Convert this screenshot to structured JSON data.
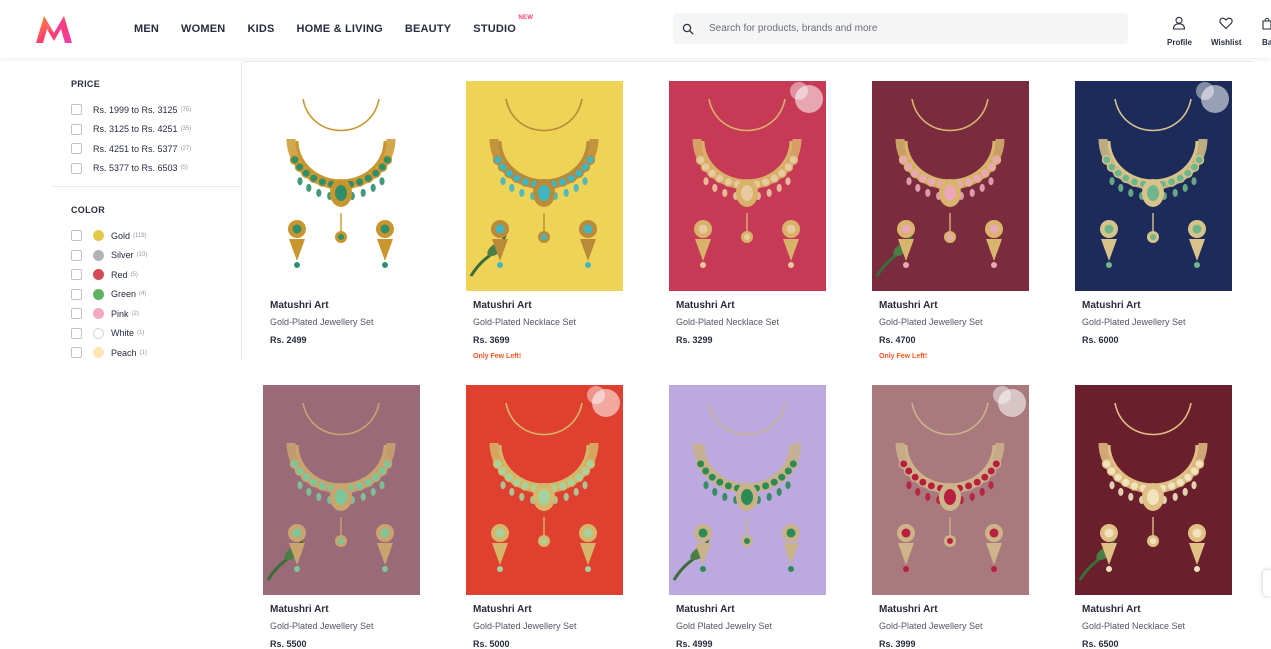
{
  "header": {
    "brand_colors": {
      "primary": "#ff3f6c",
      "accent": "#f13ab1",
      "secondary": "#ff9a28"
    },
    "nav": [
      {
        "label": "MEN"
      },
      {
        "label": "WOMEN"
      },
      {
        "label": "KIDS"
      },
      {
        "label": "HOME & LIVING"
      },
      {
        "label": "BEAUTY"
      },
      {
        "label": "STUDIO",
        "badge": "NEW"
      }
    ],
    "search": {
      "placeholder": "Search for products, brands and more",
      "icon": "search-icon"
    },
    "actions": [
      {
        "label": "Profile",
        "icon": "user-icon"
      },
      {
        "label": "Wishlist",
        "icon": "heart-icon"
      },
      {
        "label": "Ba",
        "icon": "bag-icon"
      }
    ]
  },
  "filters": {
    "price": {
      "title": "PRICE",
      "options": [
        {
          "label": "Rs. 1999 to Rs. 3125",
          "count": "(75)"
        },
        {
          "label": "Rs. 3125 to Rs. 4251",
          "count": "(35)"
        },
        {
          "label": "Rs. 4251 to Rs. 5377",
          "count": "(27)"
        },
        {
          "label": "Rs. 5377 to Rs. 6503",
          "count": "(5)"
        }
      ]
    },
    "color": {
      "title": "COLOR",
      "options": [
        {
          "label": "Gold",
          "count": "(119)",
          "swatch": "#e5c74b"
        },
        {
          "label": "Silver",
          "count": "(10)",
          "swatch": "#b3b3b3"
        },
        {
          "label": "Red",
          "count": "(5)",
          "swatch": "#d34b56"
        },
        {
          "label": "Green",
          "count": "(4)",
          "swatch": "#5eb160"
        },
        {
          "label": "Pink",
          "count": "(2)",
          "swatch": "#f1a9c4"
        },
        {
          "label": "White",
          "count": "(1)",
          "swatch": "#ffffff"
        },
        {
          "label": "Peach",
          "count": "(1)",
          "swatch": "#ffe5b4"
        }
      ]
    }
  },
  "products": [
    {
      "brand": "Matushri Art",
      "title": "Gold-Plated Jewellery Set",
      "price": "Rs. 2499",
      "stock": "",
      "bg": "#ffffff",
      "metal": "#c9962e",
      "stone": "#2f8f6b"
    },
    {
      "brand": "Matushri Art",
      "title": "Gold-Plated Necklace Set",
      "price": "Rs. 3699",
      "stock": "Only Few Left!",
      "bg": "#eed356",
      "metal": "#b88a3a",
      "stone": "#3fb6c4"
    },
    {
      "brand": "Matushri Art",
      "title": "Gold-Plated Necklace Set",
      "price": "Rs. 3299",
      "stock": "",
      "bg": "#c73a55",
      "metal": "#d9b26a",
      "stone": "#e8c9a0"
    },
    {
      "brand": "Matushri Art",
      "title": "Gold-Plated Jewellery Set",
      "price": "Rs. 4700",
      "stock": "Only Few Left!",
      "bg": "#7a2c3e",
      "metal": "#d8b46c",
      "stone": "#e9a7b8"
    },
    {
      "brand": "Matushri Art",
      "title": "Gold-Plated Jewellery Set",
      "price": "Rs. 6000",
      "stock": "",
      "bg": "#1d2b5a",
      "metal": "#d8c38a",
      "stone": "#6fb68a"
    },
    {
      "brand": "Matushri Art",
      "title": "Gold-Plated Jewellery Set",
      "price": "Rs. 5500",
      "stock": "",
      "bg": "#9b6a78",
      "metal": "#c9a46e",
      "stone": "#7cc79a"
    },
    {
      "brand": "Matushri Art",
      "title": "Gold-Plated Jewellery Set",
      "price": "Rs. 5000",
      "stock": "",
      "bg": "#e0402f",
      "metal": "#d6b76a",
      "stone": "#a4d3a0"
    },
    {
      "brand": "Matushri Art",
      "title": "Gold Plated Jewelry Set",
      "price": "Rs. 4999",
      "stock": "",
      "bg": "#bba9e0",
      "metal": "#c7b28a",
      "stone": "#2c8a54"
    },
    {
      "brand": "Matushri Art",
      "title": "Gold-Plated Jewellery Set",
      "price": "Rs. 3999",
      "stock": "",
      "bg": "#a87a7e",
      "metal": "#cdb48a",
      "stone": "#b81e3e"
    },
    {
      "brand": "Matushri Art",
      "title": "Gold-Plated Necklace Set",
      "price": "Rs. 6500",
      "stock": "",
      "bg": "#6a1f2c",
      "metal": "#e0c084",
      "stone": "#f2e3c0"
    }
  ]
}
